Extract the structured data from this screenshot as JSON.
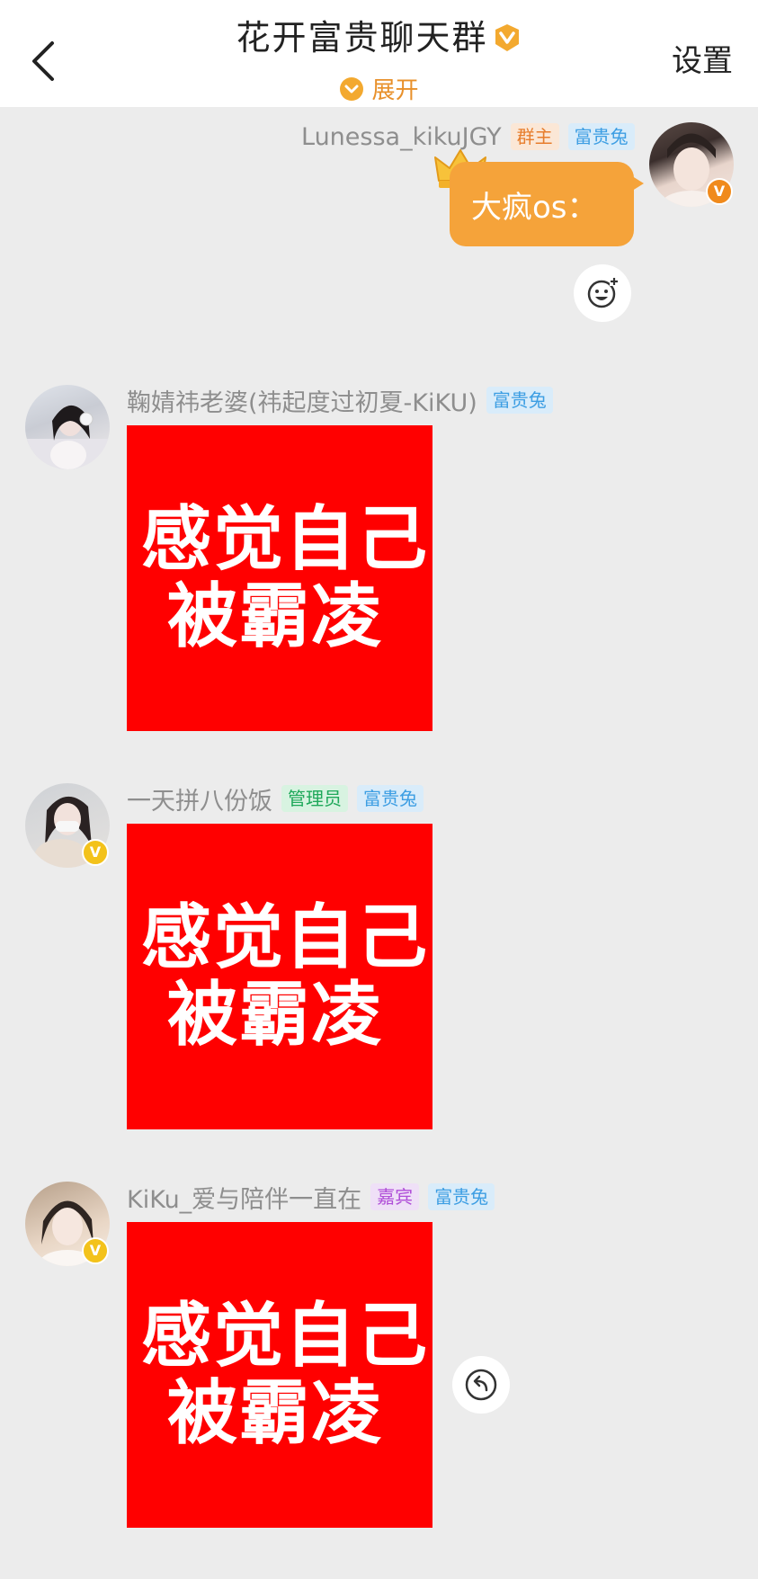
{
  "header": {
    "title": "花开富贵聊天群",
    "expand_label": "展开",
    "settings_label": "设置"
  },
  "colors": {
    "accent_orange": "#f5a33a",
    "sticker_red": "#ff0000",
    "background": "#ececec"
  },
  "messages": [
    {
      "sender": "Lunessa_kikuJGY",
      "tags": [
        "群主",
        "富贵兔"
      ],
      "side": "right",
      "verified": true,
      "type": "text",
      "text": "大疯os："
    },
    {
      "sender": "鞠婧祎老婆(祎起度过初夏-KiKU)",
      "tags": [
        "富贵兔"
      ],
      "side": "left",
      "verified": false,
      "type": "sticker",
      "sticker_text": [
        "感觉自己",
        "被霸凌"
      ]
    },
    {
      "sender": "一天拼八份饭",
      "tags": [
        "管理员",
        "富贵兔"
      ],
      "side": "left",
      "verified": true,
      "type": "sticker",
      "sticker_text": [
        "感觉自己",
        "被霸凌"
      ]
    },
    {
      "sender": "KiKu_爱与陪伴一直在",
      "tags": [
        "嘉宾",
        "富贵兔"
      ],
      "side": "left",
      "verified": true,
      "type": "sticker",
      "sticker_text": [
        "感觉自己",
        "被霸凌"
      ]
    }
  ],
  "icons": {
    "back": "chevron-left-icon",
    "verified": "v-badge-icon",
    "add_reaction": "add-emoji-icon",
    "reply": "reply-arrow-icon",
    "crown": "crown-icon"
  }
}
